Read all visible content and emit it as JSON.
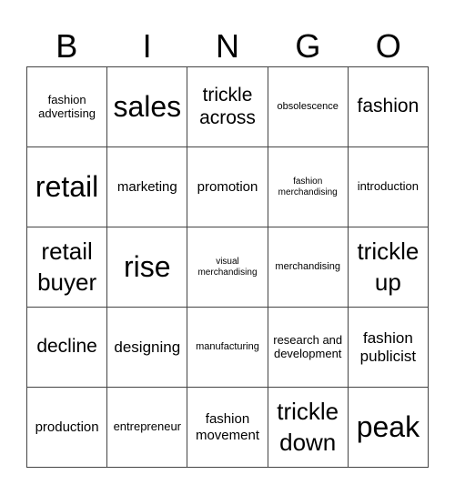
{
  "header": [
    "B",
    "I",
    "N",
    "G",
    "O"
  ],
  "grid": [
    [
      "fashion advertising",
      "sales",
      "trickle across",
      "obsolescence",
      "fashion"
    ],
    [
      "retail",
      "marketing",
      "promotion",
      "fashion merchandising",
      "introduction"
    ],
    [
      "retail buyer",
      "rise",
      "visual merchandising",
      "merchandising",
      "trickle up"
    ],
    [
      "decline",
      "designing",
      "manufacturing",
      "research and development",
      "fashion publicist"
    ],
    [
      "production",
      "entrepreneur",
      "fashion movement",
      "trickle down",
      "peak"
    ]
  ]
}
